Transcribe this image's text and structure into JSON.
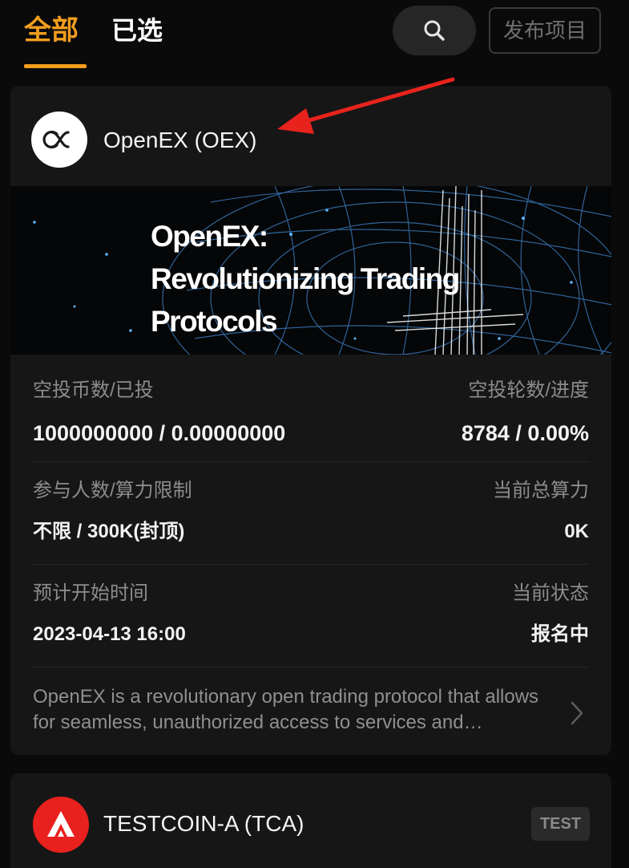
{
  "tabs": {
    "all": "全部",
    "selected": "已选"
  },
  "header": {
    "publish_label": "发布项目",
    "search_icon": "search-icon"
  },
  "project1": {
    "name": "OpenEX (OEX)",
    "logo_icon": "openex-logo-icon",
    "banner": {
      "line1": "OpenEX:",
      "line2": "Revolutionizing Trading",
      "line3": "Protocols"
    },
    "stats": {
      "airdrop_label": "空投币数/已投",
      "airdrop_value": "1000000000 / 0.00000000",
      "rounds_label": "空投轮数/进度",
      "rounds_value": "8784 / 0.00%",
      "participants_label": "参与人数/算力限制",
      "participants_value": "不限 / 300K(封顶)",
      "hashrate_label": "当前总算力",
      "hashrate_value": "0K",
      "start_label": "预计开始时间",
      "start_value": "2023-04-13 16:00",
      "status_label": "当前状态",
      "status_value": "报名中"
    },
    "description": "OpenEX is a revolutionary open trading protocol that allows for seamless, unauthorized access to services and resources"
  },
  "project2": {
    "name": "TESTCOIN-A (TCA)",
    "badge": "TEST",
    "logo_icon": "testcoin-logo-icon"
  },
  "colors": {
    "accent": "#f29d1e",
    "background": "#0a0a0a",
    "card": "#161616",
    "arrow": "#e8231d",
    "testcoin_red": "#e8211e"
  }
}
